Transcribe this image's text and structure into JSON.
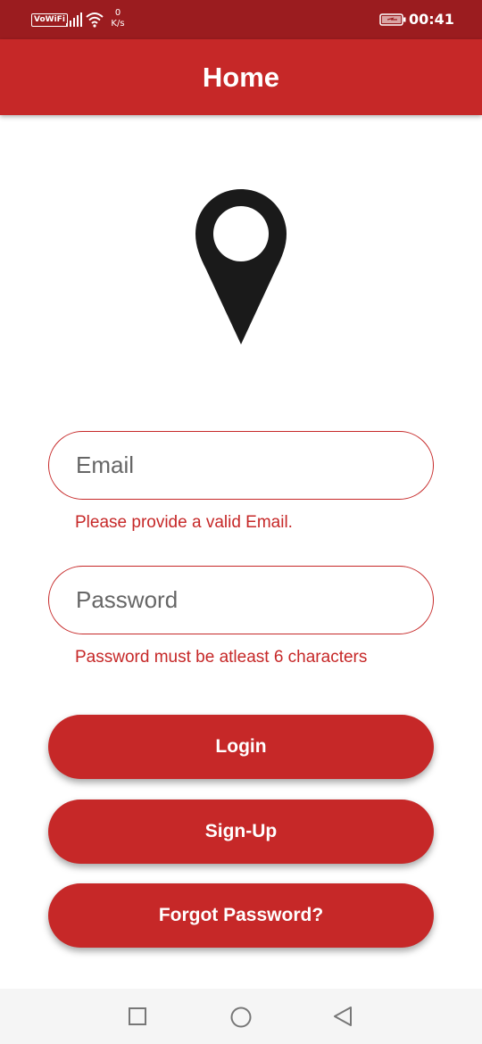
{
  "status_bar": {
    "vowifi": "VoWiFi",
    "speed_value": "0",
    "speed_unit": "K/s",
    "time": "00:41",
    "icons": [
      "vowifi-icon",
      "signal-icon",
      "wifi-icon",
      "battery-charging-icon"
    ]
  },
  "app_bar": {
    "title": "Home"
  },
  "logo": {
    "icon": "location-pin-icon"
  },
  "form": {
    "email_placeholder": "Email",
    "email_error": "Please provide a valid Email.",
    "password_placeholder": "Password",
    "password_error": "Password must be atleast 6 characters"
  },
  "buttons": {
    "login": "Login",
    "signup": "Sign-Up",
    "forgot": "Forgot Password?"
  },
  "nav_bar": {
    "icons": [
      "recents-square-icon",
      "home-circle-icon",
      "back-triangle-icon"
    ]
  },
  "colors": {
    "status_bar": "#9b1c1f",
    "primary": "#c62828",
    "pin": "#1a1a1a",
    "nav_bar": "#f5f5f5"
  }
}
